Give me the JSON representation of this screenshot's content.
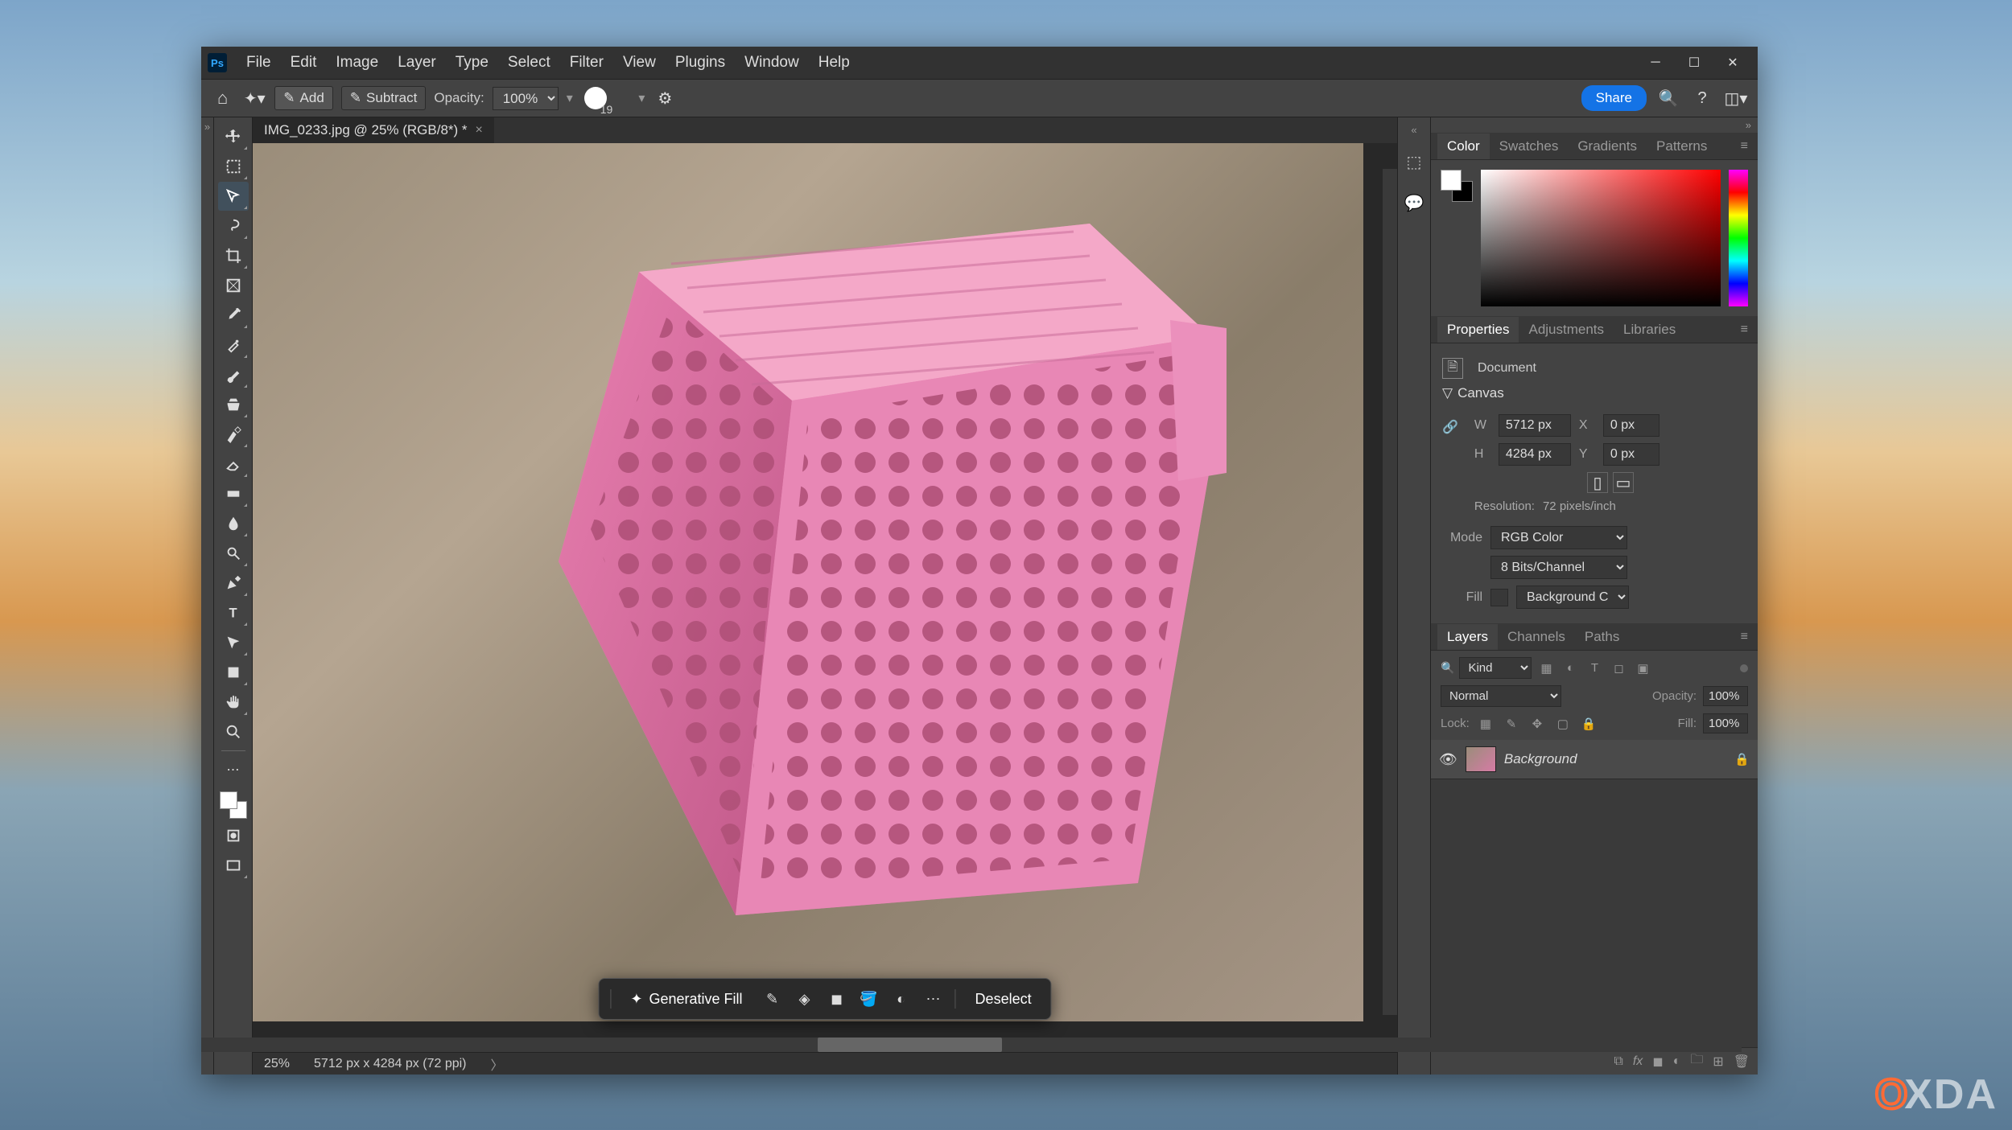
{
  "menubar": [
    "File",
    "Edit",
    "Image",
    "Layer",
    "Type",
    "Select",
    "Filter",
    "View",
    "Plugins",
    "Window",
    "Help"
  ],
  "options": {
    "add": "Add",
    "subtract": "Subtract",
    "opacity_label": "Opacity:",
    "opacity_value": "100%",
    "brush_size": "19",
    "share": "Share"
  },
  "document": {
    "tab_title": "IMG_0233.jpg @ 25% (RGB/8*) *",
    "zoom": "25%",
    "dimensions": "5712 px x 4284 px (72 ppi)"
  },
  "contextbar": {
    "genfill": "Generative Fill",
    "deselect": "Deselect"
  },
  "panels": {
    "color_tabs": [
      "Color",
      "Swatches",
      "Gradients",
      "Patterns"
    ],
    "props_tabs": [
      "Properties",
      "Adjustments",
      "Libraries"
    ],
    "layers_tabs": [
      "Layers",
      "Channels",
      "Paths"
    ]
  },
  "properties": {
    "doc_label": "Document",
    "canvas_label": "Canvas",
    "w_label": "W",
    "w_value": "5712 px",
    "h_label": "H",
    "h_value": "4284 px",
    "x_label": "X",
    "x_value": "0 px",
    "y_label": "Y",
    "y_value": "0 px",
    "resolution_label": "Resolution:",
    "resolution_value": "72 pixels/inch",
    "mode_label": "Mode",
    "mode_value": "RGB Color",
    "bits_value": "8 Bits/Channel",
    "fill_label": "Fill",
    "fill_value": "Background Color"
  },
  "layers": {
    "kind": "Kind",
    "blend_mode": "Normal",
    "opacity_label": "Opacity:",
    "opacity_value": "100%",
    "lock_label": "Lock:",
    "fill_label": "Fill:",
    "fill_value": "100%",
    "layer_name": "Background"
  },
  "watermark": "XDA"
}
